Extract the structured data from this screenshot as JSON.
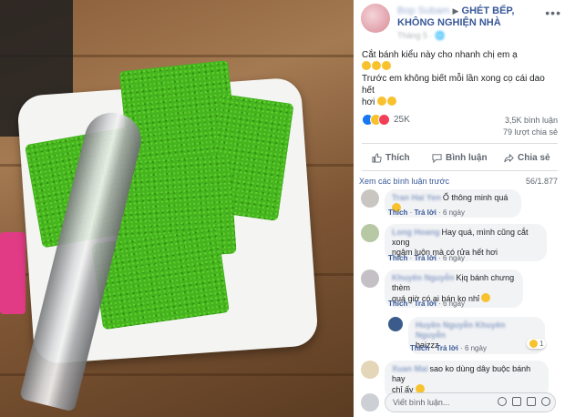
{
  "post": {
    "author_name": "Bop Subam",
    "arrow": "▶",
    "group_name": "GHÉT BẾP, KHÔNG NGHIỆN NHÀ",
    "meta": "Tháng 5 · 🌐",
    "text_line1": "Cắt bánh kiểu này cho nhanh chị em ạ",
    "text_line3": "Trước em không biết mỗi lần xong cọ cái dao hết",
    "text_line4": "hơi",
    "reaction_count": "25K",
    "comment_count": "3,5K bình luận",
    "share_count": "79 lượt chia sẻ"
  },
  "actions": {
    "like": "Thích",
    "comment": "Bình luận",
    "share": "Chia sẻ"
  },
  "comments_header": {
    "view_previous": "Xem các bình luận trước",
    "count": "56/1.877"
  },
  "comments": [
    {
      "name": "Tran Hai Yen",
      "text": "Ố thông minh quá",
      "like": "Thích",
      "reply": "Trả lời",
      "time": "6 ngày"
    },
    {
      "name": "Long Hoang",
      "text_line1": "Hay quá, mình cũng cắt xong",
      "text_line2": "ngâm luôn mà có rửa hết hơi",
      "like": "Thích",
      "reply": "Trả lời",
      "time": "6 ngày"
    },
    {
      "name": "Khuyên Nguyễn",
      "text_line1": "Kịq bánh chưng thèm",
      "text_line2": "quá giờ có ai bán ko nhỉ",
      "like": "Thích",
      "reply": "Trả lời",
      "time": "6 ngày"
    },
    {
      "name": "Huyền Nguyễn Khuyên Nguyễn",
      "text": "haizzz",
      "like": "Thích",
      "reply": "Trả lời",
      "time": "6 ngày",
      "reactions": "1"
    },
    {
      "name": "Xuan Mai",
      "text_line1": "sao ko dùng dây buộc bánh hay",
      "text_line2": "chỉ ấy"
    }
  ],
  "comment_box": {
    "placeholder": "Viết bình luận..."
  },
  "icons": {
    "like": "thumbs-up-icon",
    "comment": "speech-bubble-icon",
    "share": "share-arrow-icon",
    "more": "more-options-icon"
  },
  "colors": {
    "link_blue": "#385898",
    "facebook_blue": "#1877f2",
    "bubble_bg": "#f2f3f5"
  }
}
